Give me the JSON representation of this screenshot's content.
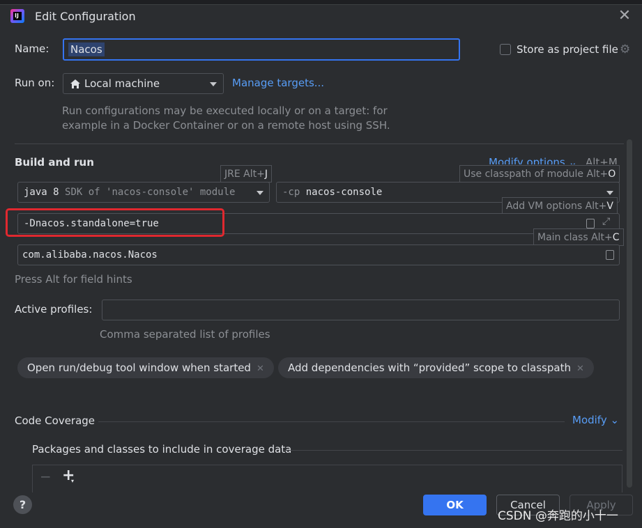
{
  "window": {
    "title": "Edit Configuration"
  },
  "name_row": {
    "label": "Name:",
    "value": "Nacos",
    "store_label": "Store as project file",
    "store_checked": false
  },
  "run_on": {
    "label": "Run on:",
    "target_value": "Local machine",
    "manage_link": "Manage targets...",
    "description_line1": "Run configurations may be executed locally or on a target: for",
    "description_line2": "example in a Docker Container or on a remote host using SSH."
  },
  "build": {
    "heading": "Build and run",
    "modify_options": "Modify options",
    "modify_shortcut": "Alt+M",
    "jre_hint": {
      "text": "JRE Alt+",
      "key": "J"
    },
    "classpath_hint": {
      "text": "Use classpath of module Alt+",
      "key": "O"
    },
    "vm_hint": {
      "text": "Add VM options Alt+",
      "key": "V"
    },
    "main_hint": {
      "text": "Main class Alt+",
      "key": "C"
    },
    "jre_prefix": "java 8",
    "jre_detail": "SDK of 'nacos-console' module",
    "cp_prefix": "-cp",
    "cp_module": "nacos-console",
    "vm_options": "-Dnacos.standalone=true",
    "main_class": "com.alibaba.nacos.Nacos",
    "field_hint": "Press Alt for field hints"
  },
  "profiles": {
    "label": "Active profiles:",
    "value": "",
    "hint": "Comma separated list of profiles"
  },
  "chips": [
    {
      "label": "Open run/debug tool window when started"
    },
    {
      "label": "Add dependencies with “provided” scope to classpath"
    }
  ],
  "coverage": {
    "heading": "Code Coverage",
    "modify": "Modify",
    "packages_label": "Packages and classes to include in coverage data"
  },
  "buttons": {
    "ok": "OK",
    "cancel": "Cancel",
    "apply": "Apply"
  },
  "watermark": "CSDN @奔跑的小十一",
  "colors": {
    "accent": "#3574f0",
    "link": "#589df6",
    "highlight_box": "#e0282f"
  }
}
